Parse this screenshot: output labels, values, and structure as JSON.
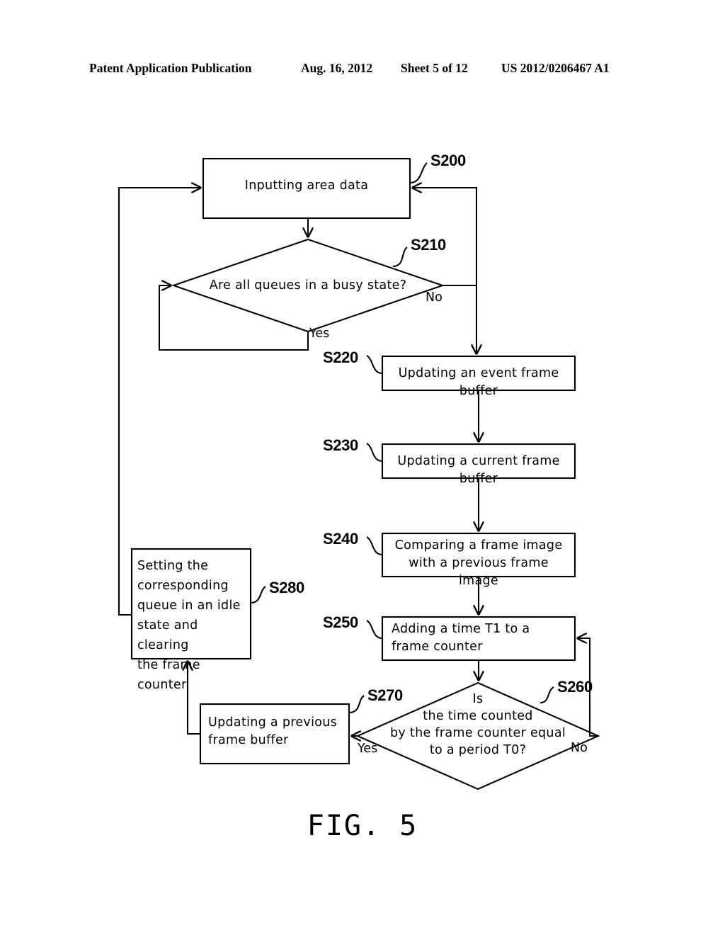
{
  "header": {
    "publication": "Patent Application Publication",
    "date": "Aug. 16, 2012",
    "sheet": "Sheet 5 of 12",
    "patent_number": "US 2012/0206467 A1"
  },
  "figure": {
    "caption": "FIG. 5",
    "type": "flowchart"
  },
  "nodes": {
    "s200": {
      "ref": "S200",
      "shape": "process",
      "text": "Inputting area data"
    },
    "s210": {
      "ref": "S210",
      "shape": "decision",
      "text": "Are all queues in a busy state?"
    },
    "s220": {
      "ref": "S220",
      "shape": "process",
      "text": "Updating an event frame buffer"
    },
    "s230": {
      "ref": "S230",
      "shape": "process",
      "text": "Updating a current frame buffer"
    },
    "s240": {
      "ref": "S240",
      "shape": "process",
      "text": "Comparing a frame image\nwith a previous frame image"
    },
    "s250": {
      "ref": "S250",
      "shape": "process",
      "text": "Adding a time T1 to a\nframe counter"
    },
    "s260": {
      "ref": "S260",
      "shape": "decision",
      "text": "Is\nthe time counted\nby the frame counter equal\nto a period T0?"
    },
    "s270": {
      "ref": "S270",
      "shape": "process",
      "text": "Updating a previous\nframe buffer"
    },
    "s280": {
      "ref": "S280",
      "shape": "process",
      "text": "Setting the\ncorresponding\nqueue in an idle\nstate and clearing\nthe frame counter"
    }
  },
  "branch_labels": {
    "s210_no": "No",
    "s210_yes": "Yes",
    "s260_no": "No",
    "s260_yes": "Yes"
  },
  "colors": {
    "ink": "#000000",
    "paper": "#ffffff"
  }
}
